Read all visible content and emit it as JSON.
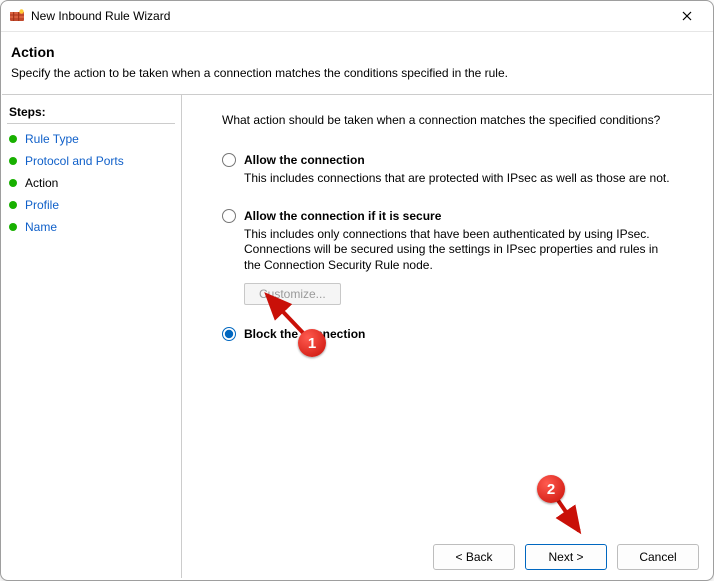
{
  "window": {
    "title": "New Inbound Rule Wizard"
  },
  "header": {
    "title": "Action",
    "subtitle": "Specify the action to be taken when a connection matches the conditions specified in the rule."
  },
  "sidebar": {
    "title": "Steps:",
    "steps": [
      {
        "label": "Rule Type",
        "active": false
      },
      {
        "label": "Protocol and Ports",
        "active": false
      },
      {
        "label": "Action",
        "active": true
      },
      {
        "label": "Profile",
        "active": false
      },
      {
        "label": "Name",
        "active": false
      }
    ]
  },
  "main": {
    "prompt": "What action should be taken when a connection matches the specified conditions?",
    "options": [
      {
        "id": "allow",
        "label": "Allow the connection",
        "desc": "This includes connections that are protected with IPsec as well as those are not.",
        "selected": false
      },
      {
        "id": "allow_secure",
        "label": "Allow the connection if it is secure",
        "desc": "This includes only connections that have been authenticated by using IPsec.  Connections will be secured using the settings in IPsec properties and rules in the Connection Security Rule node.",
        "selected": false,
        "customize_label": "Customize..."
      },
      {
        "id": "block",
        "label": "Block the connection",
        "desc": "",
        "selected": true
      }
    ]
  },
  "footer": {
    "back": "< Back",
    "next": "Next >",
    "cancel": "Cancel"
  },
  "annotations": {
    "a1": "1",
    "a2": "2"
  }
}
